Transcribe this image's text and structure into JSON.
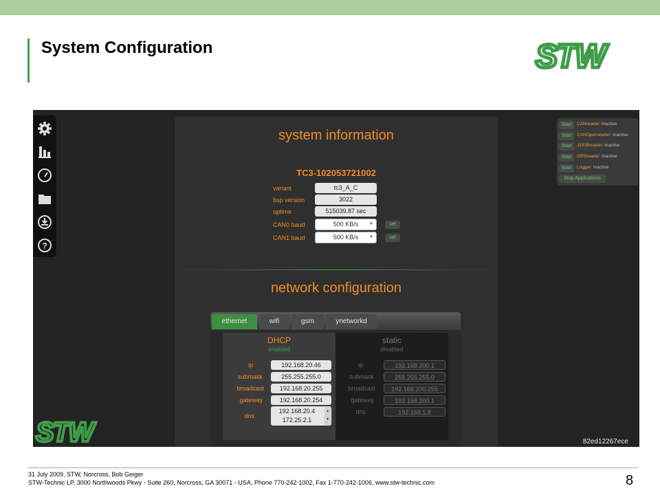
{
  "slide": {
    "title": "System Configuration",
    "footer_line1": "31 July 2009, STW, Norcross, Bob Geiger",
    "footer_line2": "STW-Technic LP, 3000 Northwoods Pkwy - Suite 260, Norcross, GA 30071 - USA, Phone 770-242-1002, Fax 1-770-242-1006, www.stw-technic.com",
    "page_number": "8",
    "logo_text": "STW",
    "colors": {
      "accent_green": "#3f9d48",
      "orange": "#f08c28",
      "top_bar": "#a9cf9b"
    }
  },
  "sidebar": {
    "items": [
      {
        "icon": "gear-icon"
      },
      {
        "icon": "bar-chart-icon"
      },
      {
        "icon": "gauge-icon"
      },
      {
        "icon": "folder-icon"
      },
      {
        "icon": "download-icon"
      },
      {
        "icon": "help-icon"
      }
    ]
  },
  "system_info": {
    "heading": "system information",
    "device_name": "TC3-102053721002",
    "rows": [
      {
        "label": "variant",
        "value": "tc3_A_C"
      },
      {
        "label": "bsp version",
        "value": "3022"
      },
      {
        "label": "uptime",
        "value": "515039.87 sec"
      }
    ],
    "baud": [
      {
        "label": "CAN0 baud",
        "value": "500 KB/s",
        "button": "set"
      },
      {
        "label": "CAN1 baud",
        "value": "500 KB/s",
        "button": "set"
      }
    ]
  },
  "network": {
    "heading": "network configuration",
    "tabs": [
      "ethernet",
      "wifi",
      "gsm",
      "ynetworkd"
    ],
    "active_tab": "ethernet",
    "dhcp": {
      "title": "DHCP",
      "status": "enabled",
      "ip": "192.168.20.46",
      "submask": "255.255.255.0",
      "broadcast": "192.168.20.255",
      "gateway": "192.168.20.254",
      "dns1": "192.168.20.4",
      "dns2": "172.25.2.1"
    },
    "static": {
      "title": "static",
      "status": "disabled",
      "ip": "192.168.200.1",
      "submask": "255.255.255.0",
      "broadcast": "192.168.200.255",
      "gateway": "192.168.200.1",
      "dns": "192.168.1.8"
    },
    "field_labels": {
      "ip": "ip",
      "submask": "submask",
      "broadcast": "broadcast",
      "gateway": "gateway",
      "dns": "dns"
    }
  },
  "applications": {
    "start_label": "Start",
    "items": [
      {
        "name": "CANreader",
        "status": "Inactive"
      },
      {
        "name": "CANOpenreader",
        "status": "Inactive"
      },
      {
        "name": "J1939reader",
        "status": "Inactive"
      },
      {
        "name": "GPSreader",
        "status": "Inactive"
      },
      {
        "name": "Logger",
        "status": "Inactive"
      }
    ],
    "stop_label": "Stop Applications"
  },
  "device_id": "82ed12267ece"
}
